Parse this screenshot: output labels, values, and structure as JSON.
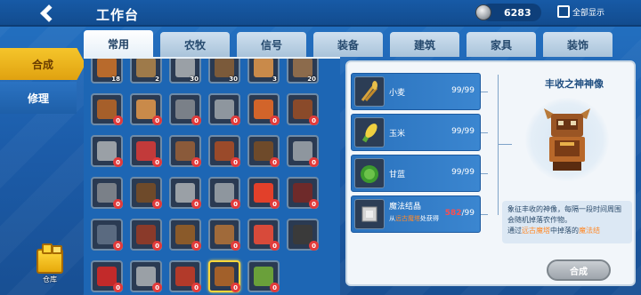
{
  "header": {
    "title": "工作台",
    "currency_value": "6283",
    "show_all_label": "全部显示"
  },
  "side_tabs": [
    {
      "label": "合成",
      "active": true
    },
    {
      "label": "修理",
      "active": false
    }
  ],
  "warehouse_label": "仓库",
  "category_tabs": [
    {
      "label": "常用",
      "active": true
    },
    {
      "label": "农牧"
    },
    {
      "label": "信号"
    },
    {
      "label": "装备"
    },
    {
      "label": "建筑"
    },
    {
      "label": "家具"
    },
    {
      "label": "装饰"
    }
  ],
  "grid": {
    "partial_row": [
      {
        "icon": "block-icon",
        "count": "18",
        "color": "#b86a2c"
      },
      {
        "icon": "tool-icon",
        "count": "2",
        "color": "#9e7a4a"
      },
      {
        "icon": "sword-icon",
        "count": "30",
        "color": "#9aa0a6"
      },
      {
        "icon": "item-icon",
        "count": "30",
        "color": "#7b5a3a"
      },
      {
        "icon": "stick-icon",
        "count": "3",
        "color": "#c98a4a"
      },
      {
        "icon": "item-icon",
        "count": "20",
        "color": "#8c6b4c"
      }
    ],
    "rows": [
      [
        {
          "icon": "workbench-icon",
          "badge": "0",
          "color": "#a65f2a"
        },
        {
          "icon": "torch-icon",
          "badge": "0",
          "color": "#c98a4a"
        },
        {
          "icon": "statue-icon",
          "badge": "0",
          "color": "#7a8088"
        },
        {
          "icon": "funnel-icon",
          "badge": "0",
          "color": "#8e969e"
        },
        {
          "icon": "torch-icon",
          "badge": "0",
          "color": "#d2642a"
        },
        {
          "icon": "shelf-icon",
          "badge": "0",
          "color": "#8a4a2a"
        },
        null
      ],
      [
        {
          "icon": "furnace-icon",
          "badge": "0",
          "color": "#9aa0a6"
        },
        {
          "icon": "machine-icon",
          "badge": "0",
          "color": "#c23a3a"
        },
        {
          "icon": "machine-icon",
          "badge": "0",
          "color": "#8a5a3a"
        },
        {
          "icon": "chest-icon",
          "badge": "0",
          "color": "#9a4a2a"
        },
        {
          "icon": "pickaxe-icon",
          "badge": "0",
          "color": "#6e4a2a"
        },
        {
          "icon": "pickaxe-icon",
          "badge": "0",
          "color": "#8e969e"
        },
        null
      ],
      [
        {
          "icon": "pickaxe-icon",
          "badge": "0",
          "color": "#7a8088"
        },
        {
          "icon": "axe-icon",
          "badge": "0",
          "color": "#6e4a2a"
        },
        {
          "icon": "axe-icon",
          "badge": "0",
          "color": "#9aa0a6"
        },
        {
          "icon": "helmet-icon",
          "badge": "0",
          "color": "#8e969e"
        },
        {
          "icon": "horn-icon",
          "badge": "0",
          "color": "#e2402a"
        },
        {
          "icon": "hammer-icon",
          "badge": "0",
          "color": "#6e2a2a"
        },
        null
      ],
      [
        {
          "icon": "machine-icon",
          "badge": "0",
          "color": "#5a6a80"
        },
        {
          "icon": "door-icon",
          "badge": "0",
          "color": "#8a3a2a"
        },
        {
          "icon": "window-icon",
          "badge": "0",
          "color": "#8a5a2a"
        },
        {
          "icon": "crate-icon",
          "badge": "0",
          "color": "#a06a3a"
        },
        {
          "icon": "potion-icon",
          "badge": "0",
          "color": "#d84a3a"
        },
        {
          "icon": "bomb-icon",
          "badge": "0",
          "color": "#3a3a3a"
        },
        null
      ],
      [
        {
          "icon": "dynamite-icon",
          "badge": "0",
          "color": "#c22a2a"
        },
        {
          "icon": "machine-icon",
          "badge": "0",
          "color": "#9aa0a6"
        },
        {
          "icon": "barrel-icon",
          "badge": "0",
          "color": "#b23a2a"
        },
        {
          "icon": "harvest-god-statue-icon",
          "badge": "0",
          "color": "#a2602a",
          "selected": true
        },
        {
          "icon": "tree-statue-icon",
          "badge": "0",
          "color": "#6aa03a"
        },
        null,
        null
      ]
    ]
  },
  "recipe": {
    "materials": [
      {
        "icon": "wheat-icon",
        "name": "小麦",
        "qty": "99/99",
        "color": "#d9a33a"
      },
      {
        "icon": "corn-icon",
        "name": "玉米",
        "qty": "99/99",
        "color": "#e8c83a"
      },
      {
        "icon": "cabbage-icon",
        "name": "甘蓝",
        "qty": "99/99",
        "color": "#4aa83a"
      },
      {
        "icon": "magic-crystal-icon",
        "name": "魔法结晶",
        "qty_have": "582",
        "qty_need": "/99",
        "source_prefix": "从",
        "source_highlight": "远古魔塔",
        "source_suffix": "处获得",
        "color": "#c8c8c8"
      }
    ],
    "product": {
      "name": "丰收之神神像",
      "icon": "harvest-god-statue-icon",
      "desc_1": "象征丰收的神像，每隔一段时间周围会随机掉落农作物。",
      "desc_2_prefix": "通过",
      "desc_2_hl1": "远古魔塔",
      "desc_2_mid": "中掉落的",
      "desc_2_hl2": "魔法结"
    },
    "craft_label": "合成"
  }
}
